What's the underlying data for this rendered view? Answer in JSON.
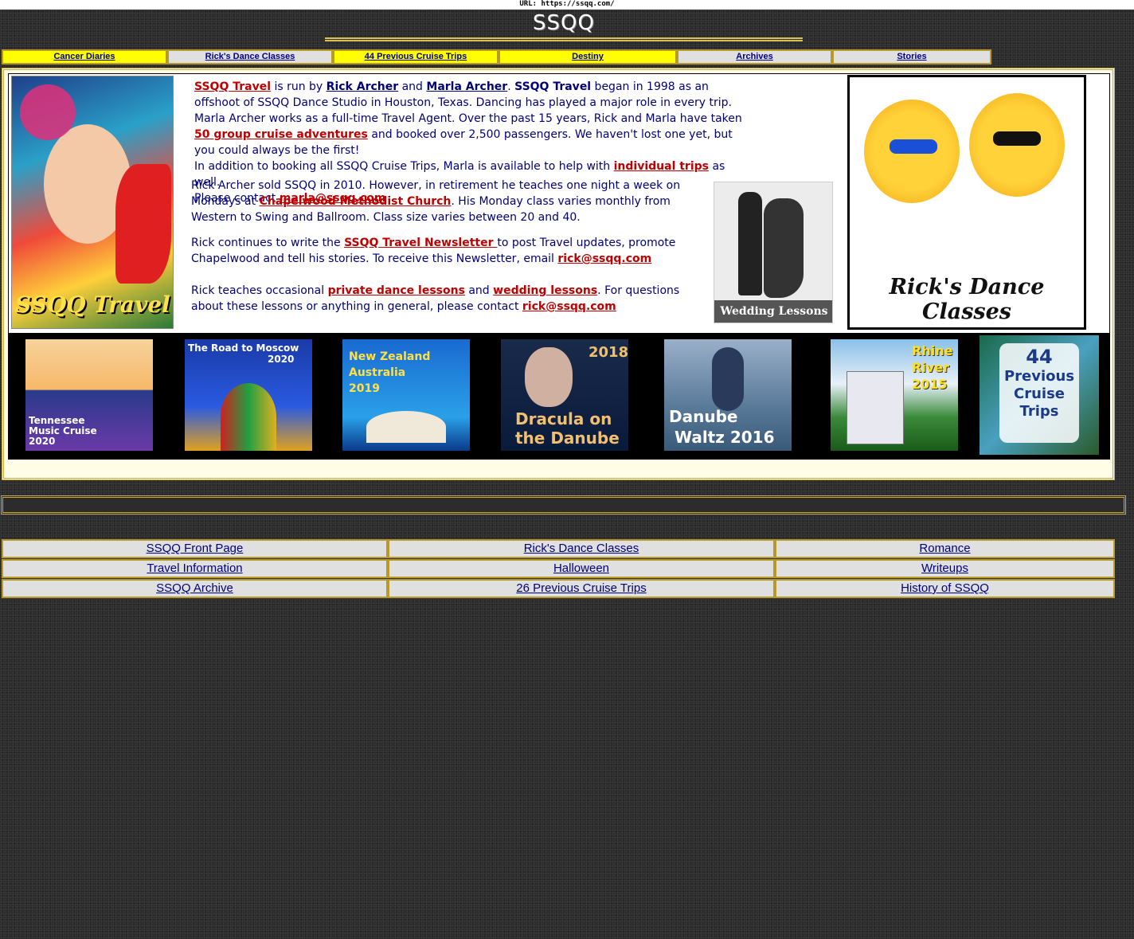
{
  "url_bar": "URL: https://ssqq.com/",
  "site_title": "SSQQ",
  "top_nav": [
    {
      "label": "Cancer Diaries"
    },
    {
      "label": "Rick's Dance Classes"
    },
    {
      "label": "44 Previous Cruise Trips"
    },
    {
      "label": "Destiny"
    },
    {
      "label": "Archives"
    },
    {
      "label": "Stories"
    }
  ],
  "intro": {
    "ssqq_travel": "SSQQ Travel",
    "t1": " is run by ",
    "rick": "Rick Archer",
    "and": " and ",
    "marla": "Marla Archer",
    "t2": ".  ",
    "ssqq_travel_bold": "SSQQ Travel",
    "t3": " began in 1998 as an offshoot of SSQQ Dance Studio in Houston, Texas.  Dancing has played a major role in every trip.  Marla Archer works as a full-time Travel Agent. Over the past 15 years, Rick and Marla have taken ",
    "fifty": "50 group cruise adventures",
    "t4": " and booked over 2,500 passengers.  We haven't lost one yet, but you could always be the first!",
    "t5": "In addition to booking all SSQQ Cruise Trips, Marla is available to help with ",
    "individual": "individual trips",
    "t6": " as well.",
    "t7": "Please contact ",
    "marla_email": "marla@ssqq.com"
  },
  "para2": {
    "t1": "Rick Archer sold SSQQ in 2010.  However, in retirement he teaches one night a week on Mondays at ",
    "church": "Chapelwood Methodist Church",
    "t2": ".   His Monday class varies monthly from Western to Swing and Ballroom.   Class size varies between 20 and 40."
  },
  "para3": {
    "t1": "Rick continues to write the ",
    "newsletter": "SSQQ Travel Newsletter ",
    "t2": "to post Travel updates, promote Chapelwood and tell his stories.  To receive this Newsletter, email ",
    "email": "rick@ssqq.com"
  },
  "para4": {
    "t1": "Rick teaches occasional ",
    "private": "private dance lessons",
    "and": " and ",
    "wedding": "wedding lessons",
    "t2": ".  For questions about these lessons or anything in general, please contact  ",
    "email": "rick@ssqq.com"
  },
  "images": {
    "left_logo": "SSQQ Travel",
    "wedding": "Wedding Lessons",
    "rick_classes": "Rick's Dance Classes"
  },
  "posters": [
    {
      "lines": [
        "Tennessee",
        "Music Cruise",
        "2020"
      ]
    },
    {
      "lines": [
        "The Road to Moscow",
        "2020"
      ]
    },
    {
      "lines": [
        "New Zealand",
        "Australia",
        "2019"
      ]
    },
    {
      "lines": [
        "2018",
        "Dracula on",
        "the Danube"
      ]
    },
    {
      "lines": [
        "Danube",
        "Waltz 2016"
      ]
    },
    {
      "lines": [
        "Rhine",
        "River",
        "2015"
      ]
    },
    {
      "lines": [
        "44",
        "Previous",
        "Cruise",
        "Trips"
      ]
    }
  ],
  "bottom_nav": [
    [
      "SSQQ Front Page",
      "Rick's Dance Classes",
      "Romance"
    ],
    [
      "Travel Information",
      "Halloween",
      "Writeups"
    ],
    [
      "SSQQ Archive",
      "26 Previous Cruise Trips",
      "History of SSQQ"
    ]
  ]
}
